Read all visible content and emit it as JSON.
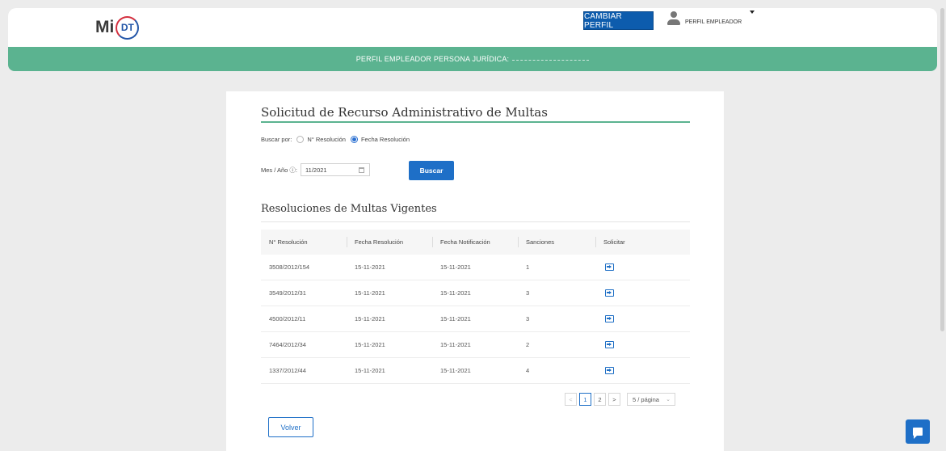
{
  "header": {
    "logo_text": "Mi",
    "logo_badge": "DT",
    "change_profile_label": "CAMBIAR PERFIL",
    "user_label": "PERFIL EMPLEADOR"
  },
  "banner": {
    "text": "PERFIL EMPLEADOR PERSONA JURÍDICA:"
  },
  "page": {
    "title": "Solicitud de Recurso Administrativo de Multas"
  },
  "search": {
    "label": "Buscar por:",
    "options": [
      {
        "label": "N° Resolución",
        "checked": false
      },
      {
        "label": "Fecha Resolución",
        "checked": true
      }
    ],
    "month_year_label": "Mes / Año ⓘ:",
    "month_year_value": "11/2021",
    "button_label": "Buscar"
  },
  "results": {
    "title": "Resoluciones de Multas Vigentes",
    "columns": [
      "N° Resolución",
      "Fecha Resolución",
      "Fecha Notificación",
      "Sanciones",
      "Solicitar"
    ],
    "rows": [
      {
        "resolucion": "3508/2012/154",
        "fecha_resolucion": "15-11-2021",
        "fecha_notificacion": "15-11-2021",
        "sanciones": "1"
      },
      {
        "resolucion": "3549/2012/31",
        "fecha_resolucion": "15-11-2021",
        "fecha_notificacion": "15-11-2021",
        "sanciones": "3"
      },
      {
        "resolucion": "4500/2012/11",
        "fecha_resolucion": "15-11-2021",
        "fecha_notificacion": "15-11-2021",
        "sanciones": "3"
      },
      {
        "resolucion": "7464/2012/34",
        "fecha_resolucion": "15-11-2021",
        "fecha_notificacion": "15-11-2021",
        "sanciones": "2"
      },
      {
        "resolucion": "1337/2012/44",
        "fecha_resolucion": "15-11-2021",
        "fecha_notificacion": "15-11-2021",
        "sanciones": "4"
      }
    ]
  },
  "pagination": {
    "prev": "<",
    "pages": [
      "1",
      "2"
    ],
    "current_page": "1",
    "next": ">",
    "page_size": "5 / página"
  },
  "back_button_label": "Volver",
  "icons": {
    "request": "enter-icon",
    "chat": "chat-icon",
    "user": "user-icon",
    "calendar": "calendar-icon"
  },
  "colors": {
    "brand_green": "#5bb390",
    "primary_blue": "#1e6fc7",
    "header_button": "#0d5cad"
  }
}
